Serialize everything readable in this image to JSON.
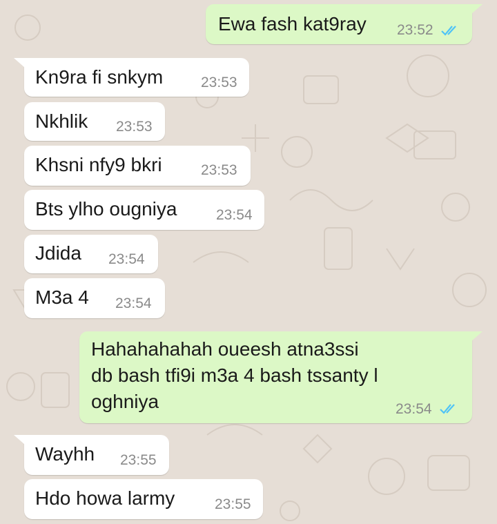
{
  "messages": [
    {
      "direction": "outgoing",
      "text": "Ewa fash kat9ray",
      "time": "23:52",
      "status": "read",
      "status_icon": "double-check-icon"
    },
    {
      "direction": "incoming",
      "text": "Kn9ra fi snkym",
      "time": "23:53"
    },
    {
      "direction": "incoming",
      "text": "Nkhlik",
      "time": "23:53"
    },
    {
      "direction": "incoming",
      "text": "Khsni nfy9 bkri",
      "time": "23:53"
    },
    {
      "direction": "incoming",
      "text": "Bts ylho ougniya",
      "time": "23:54"
    },
    {
      "direction": "incoming",
      "text": "Jdida",
      "time": "23:54"
    },
    {
      "direction": "incoming",
      "text": "M3a 4",
      "time": "23:54"
    },
    {
      "direction": "outgoing",
      "text": "Hahahahahah oueesh atna3ssi\ndb bash tfi9i m3a 4 bash tssanty l\noghniya",
      "time": "23:54",
      "status": "read",
      "status_icon": "double-check-icon"
    },
    {
      "direction": "incoming",
      "text": "Wayhh",
      "time": "23:55"
    },
    {
      "direction": "incoming",
      "text": "Hdo howa larmy",
      "time": "23:55"
    }
  ],
  "colors": {
    "chat_background": "#e6ded6",
    "incoming_bubble": "#ffffff",
    "outgoing_bubble": "#dcf8c6",
    "timestamp": "#8a8a8a",
    "read_ticks": "#4fc3f7"
  }
}
